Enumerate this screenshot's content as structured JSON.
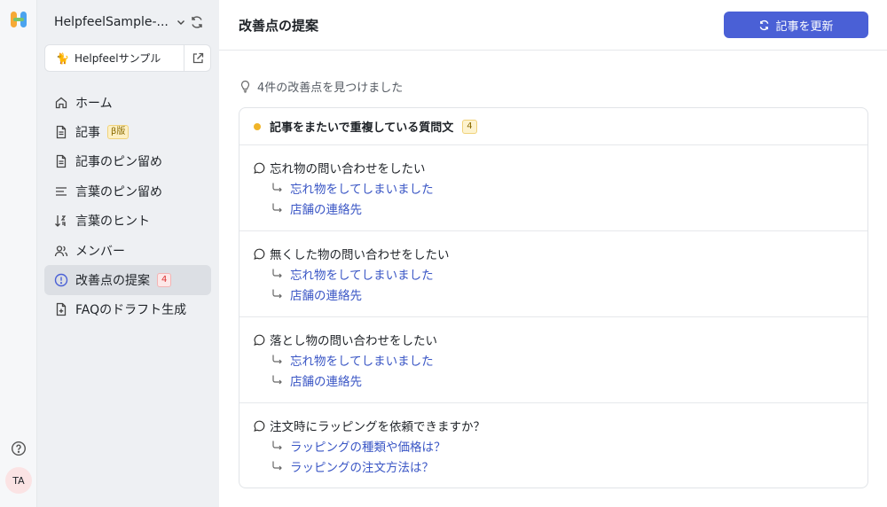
{
  "workspace": {
    "name": "HelpfeelSample-..."
  },
  "site": {
    "name": "Helpfeelサンプル"
  },
  "nav": {
    "items": [
      {
        "label": "ホーム"
      },
      {
        "label": "記事",
        "badge": "β版"
      },
      {
        "label": "記事のピン留め"
      },
      {
        "label": "言葉のピン留め"
      },
      {
        "label": "言葉のヒント"
      },
      {
        "label": "メンバー"
      },
      {
        "label": "改善点の提案",
        "badge": "4"
      },
      {
        "label": "FAQのドラフト生成"
      }
    ]
  },
  "user": {
    "initials": "TA"
  },
  "header": {
    "title": "改善点の提案",
    "update_label": "記事を更新"
  },
  "summary": {
    "text": "4件の改善点を見つけました"
  },
  "suggestion": {
    "title": "記事をまたいで重複している質問文",
    "count": "4",
    "groups": [
      {
        "question": "忘れ物の問い合わせをしたい",
        "links": [
          "忘れ物をしてしまいました",
          "店舗の連絡先"
        ]
      },
      {
        "question": "無くした物の問い合わせをしたい",
        "links": [
          "忘れ物をしてしまいました",
          "店舗の連絡先"
        ]
      },
      {
        "question": "落とし物の問い合わせをしたい",
        "links": [
          "忘れ物をしてしまいました",
          "店舗の連絡先"
        ]
      },
      {
        "question": "注文時にラッピングを依頼できますか？",
        "links": [
          "ラッピングの種類や価格は？",
          "ラッピングの注文方法は？"
        ]
      }
    ]
  },
  "colors": {
    "accent": "#4a60d6",
    "link": "#3a56c5",
    "warning_dot": "#f0b429"
  }
}
